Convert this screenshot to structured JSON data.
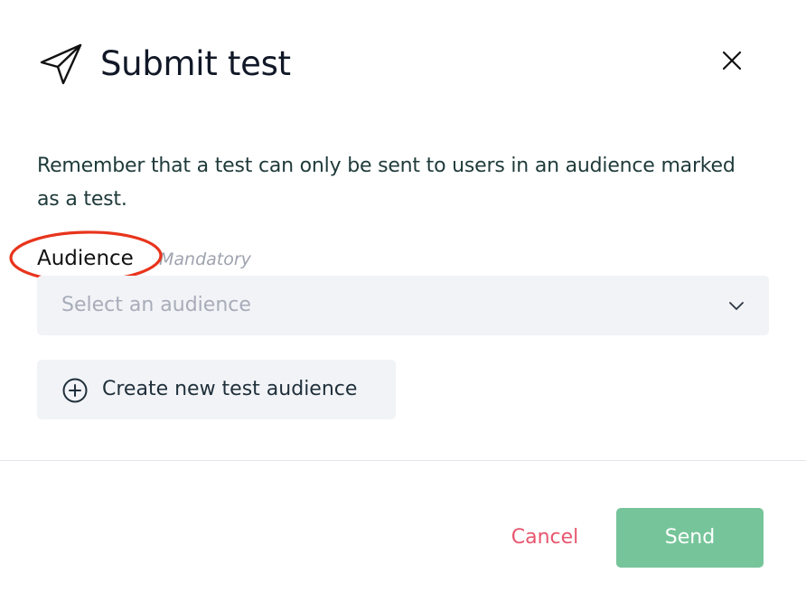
{
  "dialog": {
    "title": "Submit test",
    "header_icon": "paper-plane-icon",
    "close_icon": "close-icon",
    "description": "Remember that a test can only be sent to users in an audience marked as a test.",
    "audience_field": {
      "label": "Audience",
      "hint": "Mandatory",
      "placeholder": "Select an audience",
      "value": "",
      "chevron_icon": "chevron-down-icon"
    },
    "create_audience_button": {
      "label": "Create new test audience",
      "icon": "plus-circle-icon"
    },
    "footer": {
      "cancel_label": "Cancel",
      "send_label": "Send"
    }
  },
  "colors": {
    "title_text": "#111827",
    "body_text": "#1f3a3a",
    "hint_text": "#9ea3ae",
    "field_background": "#f2f3f7",
    "cancel_text": "#e8566e",
    "send_background": "#76c59a",
    "send_text": "#ffffff",
    "annotation_ring": "#e8341c"
  }
}
